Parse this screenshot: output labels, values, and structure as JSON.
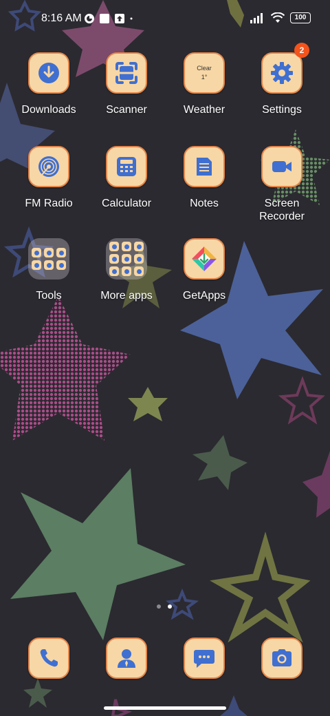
{
  "status_bar": {
    "time": "8:16 AM",
    "battery": "100",
    "icons": [
      "app-notification-icon",
      "square-notification-icon",
      "upload-notification-icon",
      "signal-icon",
      "wifi-icon",
      "battery-icon"
    ]
  },
  "apps": {
    "downloads": {
      "label": "Downloads",
      "icon": "download-arrow-icon"
    },
    "scanner": {
      "label": "Scanner",
      "icon": "scanner-icon"
    },
    "weather": {
      "label": "Weather",
      "line1": "Clear",
      "line2": "1°"
    },
    "settings": {
      "label": "Settings",
      "icon": "gear-icon",
      "badge": "2"
    },
    "fm_radio": {
      "label": "FM Radio",
      "icon": "radio-icon"
    },
    "calculator": {
      "label": "Calculator",
      "icon": "calculator-icon"
    },
    "notes": {
      "label": "Notes",
      "icon": "notes-icon"
    },
    "screen_recorder": {
      "label": "Screen Recorder",
      "line1": "Screen",
      "line2": "Recorder",
      "icon": "video-camera-icon"
    },
    "tools": {
      "label": "Tools"
    },
    "more_apps": {
      "label": "More apps"
    },
    "getapps": {
      "label": "GetApps",
      "icon": "getapps-icon"
    }
  },
  "dock": {
    "phone": {
      "icon": "phone-icon"
    },
    "contacts": {
      "icon": "contacts-icon"
    },
    "messages": {
      "icon": "messages-icon"
    },
    "camera": {
      "icon": "camera-icon"
    }
  },
  "page_indicator": {
    "pages": 2,
    "active": 2
  },
  "colors": {
    "background": "#2b2a30",
    "icon_bg": "#f7d7a5",
    "icon_border": "#e4854a",
    "icon_glyph": "#3f6fd1",
    "badge": "#f3541c"
  }
}
